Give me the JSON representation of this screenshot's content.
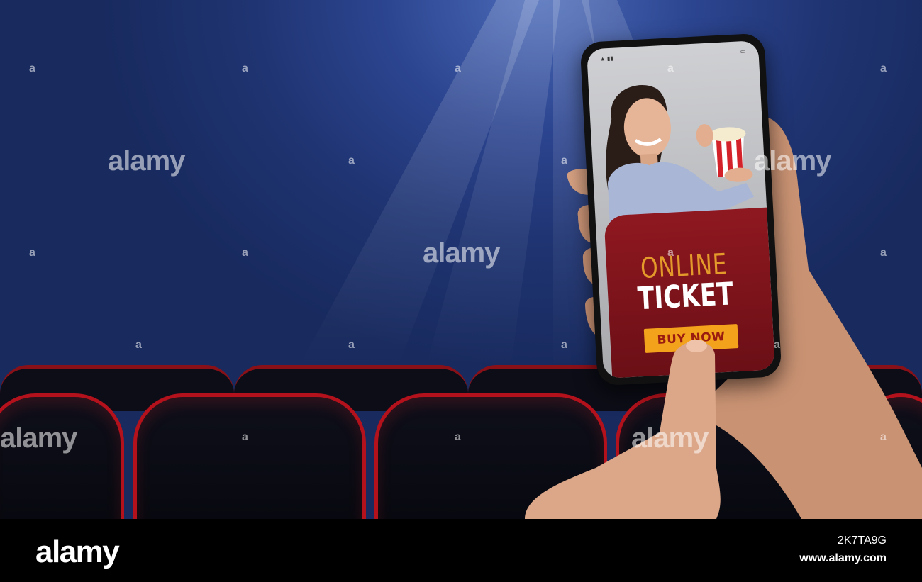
{
  "phone_screen": {
    "headline_line1": "ONLINE",
    "headline_line2": "TICKET",
    "cta_label": "BUY NOW"
  },
  "watermark": {
    "text": "alamy",
    "letter": "a"
  },
  "footer": {
    "logo": "alamy",
    "image_id": "2K7TA9G",
    "url": "www.alamy.com"
  },
  "colors": {
    "background_blue": "#1f3472",
    "seat_red": "#b3121c",
    "card_red": "#7d141c",
    "headline_orange": "#e49a2a",
    "button_orange": "#f3a21b"
  }
}
